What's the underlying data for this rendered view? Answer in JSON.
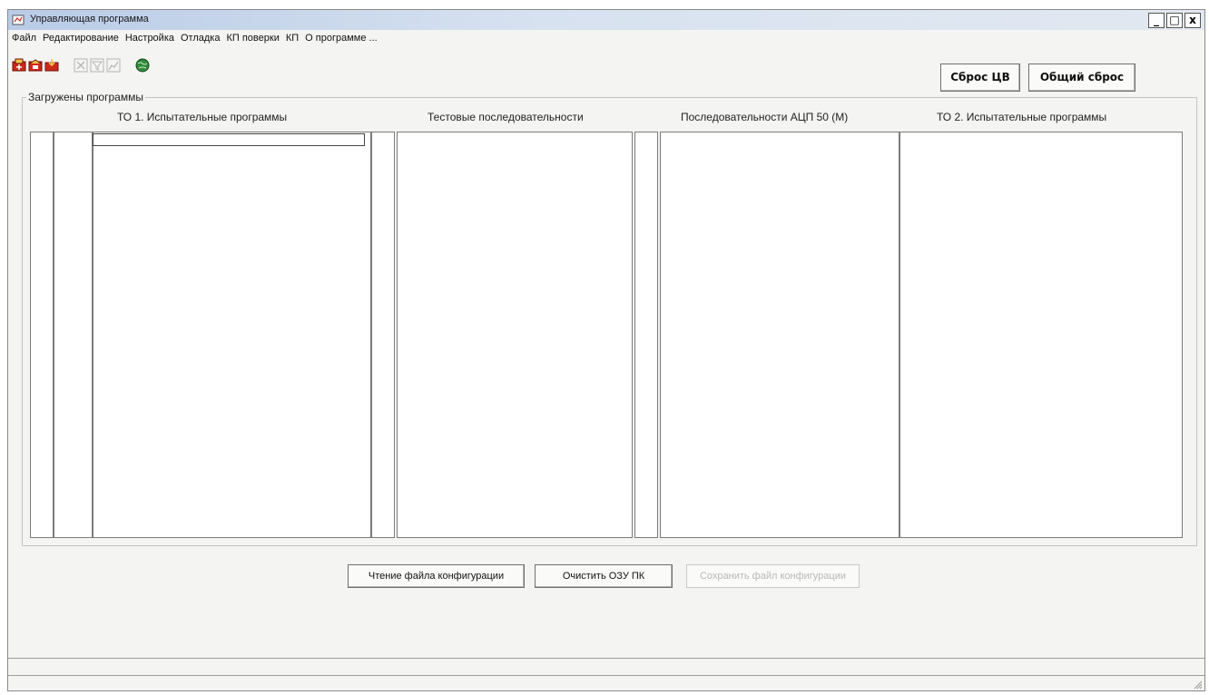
{
  "window": {
    "title": "Управляющая программа",
    "controls": {
      "minimize": "_",
      "maximize": "□",
      "close": "x"
    }
  },
  "menu": [
    "Файл",
    "Редактирование",
    "Настройка",
    "Отладка",
    "КП поверки",
    "КП",
    "О программе ..."
  ],
  "toolbar": {
    "icons": [
      "open-red-icon",
      "open-folder-red-icon",
      "load-red-icon",
      "cut-gray-icon",
      "filter-gray-icon",
      "chart-gray-icon",
      "globe-icon"
    ]
  },
  "actions": {
    "reset_cv": "Сброс ЦВ",
    "general_reset": "Общий сброс"
  },
  "programs_group": {
    "legend": "Загружены программы",
    "columns": [
      "ТО 1. Испытательные программы",
      "Тестовые последовательности",
      "Последовательности АЦП 50 (М)",
      "ТО 2. Испытательные программы"
    ]
  },
  "bottom_buttons": {
    "read_config": "Чтение файла конфигурации",
    "clear_ram": "Очистить ОЗУ ПК",
    "save_config": "Сохранить файл конфигурации"
  },
  "colors": {
    "titlebar": "#c5d4ea",
    "background": "#f4f4f2",
    "icon_red": "#cc2a1a",
    "icon_disabled": "#b5b5b5"
  }
}
